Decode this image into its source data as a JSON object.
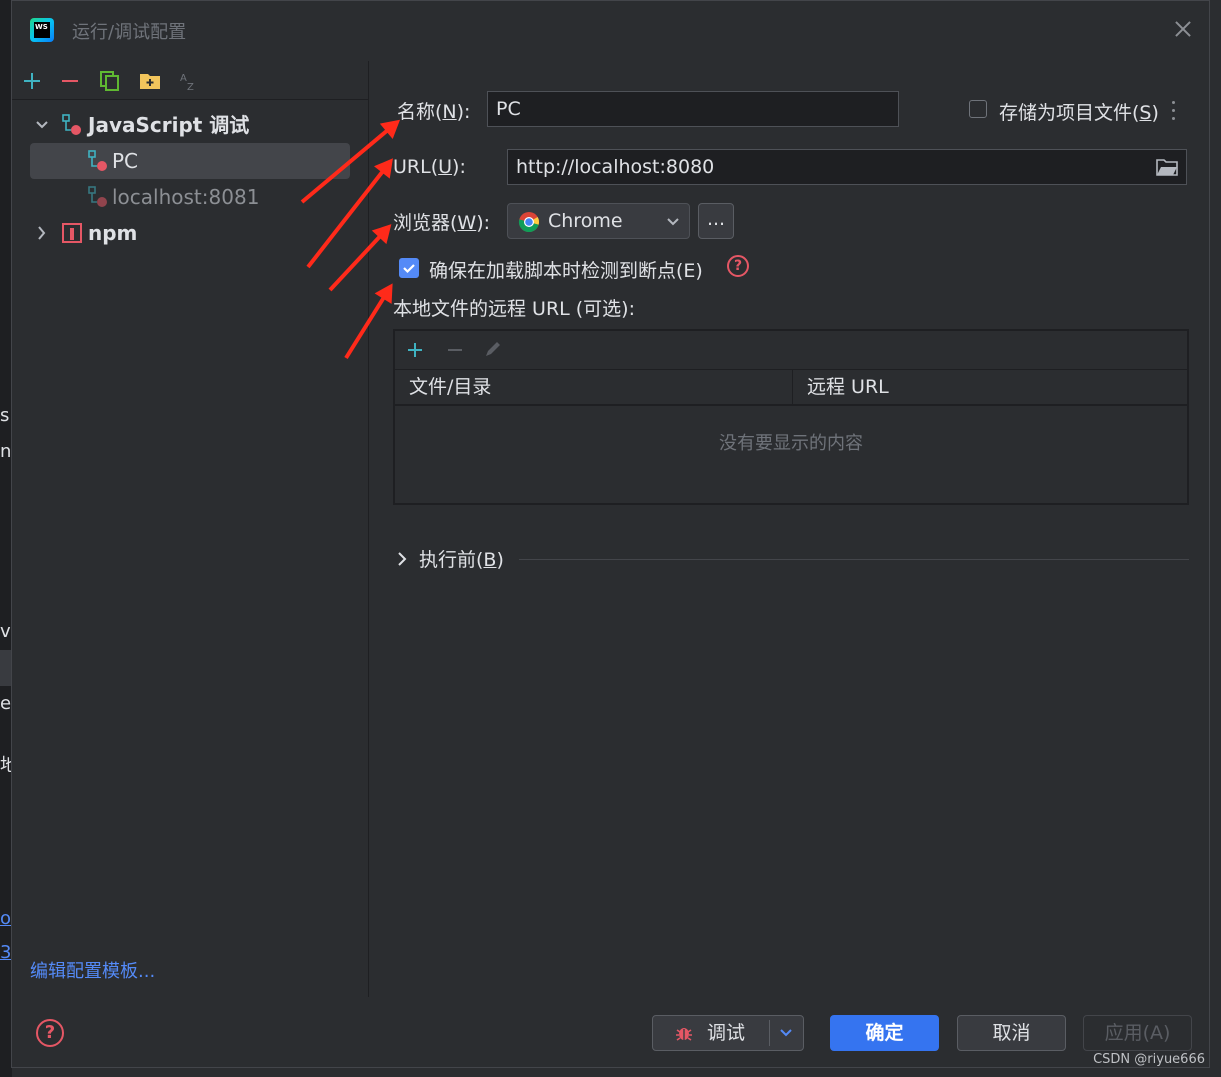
{
  "window": {
    "title": "运行/调试配置"
  },
  "background": {
    "frag1": "s",
    "frag2": "n",
    "frag3": "v",
    "frag4": "e",
    "frag5": "地",
    "frag6": "os",
    "frag7": "3"
  },
  "tree": {
    "group_label": "JavaScript 调试",
    "items": [
      {
        "label": "PC"
      },
      {
        "label": "localhost:8081"
      }
    ],
    "npm_label": "npm"
  },
  "edit_templates_link": "编辑配置模板...",
  "form": {
    "name_label_pre": "名称(",
    "name_label_key": "N",
    "name_label_post": "):",
    "name_value": "PC",
    "store_label_pre": "存储为项目文件(",
    "store_label_key": "S",
    "store_label_post": ")",
    "url_label_pre": "URL(",
    "url_label_key": "U",
    "url_label_post": "):",
    "url_value": "http://localhost:8080",
    "browser_label_pre": "浏览器(",
    "browser_label_key": "W",
    "browser_label_post": "):",
    "browser_value": "Chrome",
    "browser_more": "...",
    "breakpoint_label": "确保在加载脚本时检测到断点(E)",
    "breakpoint_checked": true,
    "remote_urls_label": "本地文件的远程 URL (可选):"
  },
  "table": {
    "columns": [
      "文件/目录",
      "远程 URL"
    ],
    "empty_text": "没有要显示的内容"
  },
  "before_launch": {
    "label_pre": "执行前(",
    "label_key": "B",
    "label_post": ")"
  },
  "buttons": {
    "debug": "调试",
    "ok": "确定",
    "cancel": "取消",
    "apply": "应用(A)"
  },
  "watermark": "CSDN @riyue666",
  "colors": {
    "accent": "#3574f0",
    "link": "#548af7",
    "annotation_arrow": "#ff2a1a",
    "help": "#e55765"
  }
}
